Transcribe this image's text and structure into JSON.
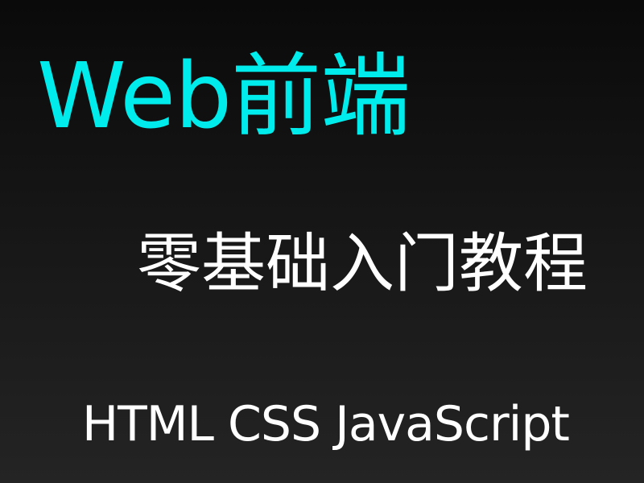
{
  "banner": {
    "title": "Web前端",
    "subtitle": "零基础入门教程",
    "technologies": "HTML CSS JavaScript",
    "colors": {
      "title": "#00ecec",
      "text": "#ffffff",
      "background": "#1a1a1a"
    }
  }
}
